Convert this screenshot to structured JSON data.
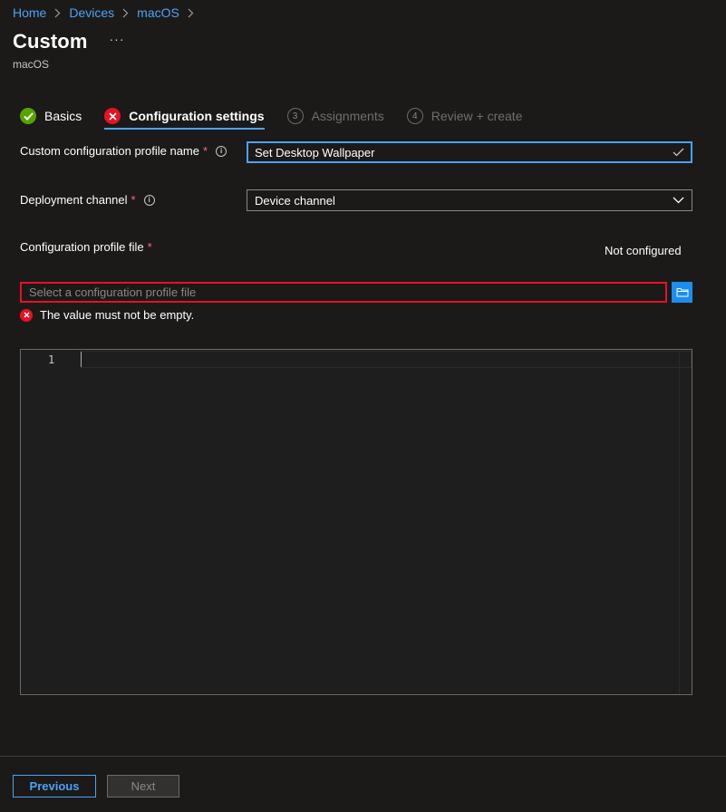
{
  "breadcrumb": [
    {
      "label": "Home"
    },
    {
      "label": "Devices"
    },
    {
      "label": "macOS"
    }
  ],
  "header": {
    "title": "Custom",
    "more_label": "···",
    "subtitle": "macOS"
  },
  "steps": [
    {
      "label": "Basics",
      "state": "done"
    },
    {
      "label": "Configuration settings",
      "state": "error"
    },
    {
      "label": "Assignments",
      "number": "3",
      "state": "disabled"
    },
    {
      "label": "Review + create",
      "number": "4",
      "state": "disabled"
    }
  ],
  "form": {
    "profile_name": {
      "label": "Custom configuration profile name",
      "required_mark": "*",
      "value": "Set Desktop Wallpaper"
    },
    "deployment_channel": {
      "label": "Deployment channel",
      "required_mark": "*",
      "value": "Device channel"
    },
    "profile_file": {
      "label": "Configuration profile file",
      "required_mark": "*",
      "status": "Not configured",
      "placeholder": "Select a configuration profile file",
      "error": "The value must not be empty."
    }
  },
  "editor": {
    "line_number": "1"
  },
  "footer": {
    "previous_label": "Previous",
    "next_label": "Next"
  },
  "colors": {
    "accent": "#4aa3f7",
    "error": "#e81123",
    "success": "#57a300",
    "background": "#1b1a19"
  }
}
